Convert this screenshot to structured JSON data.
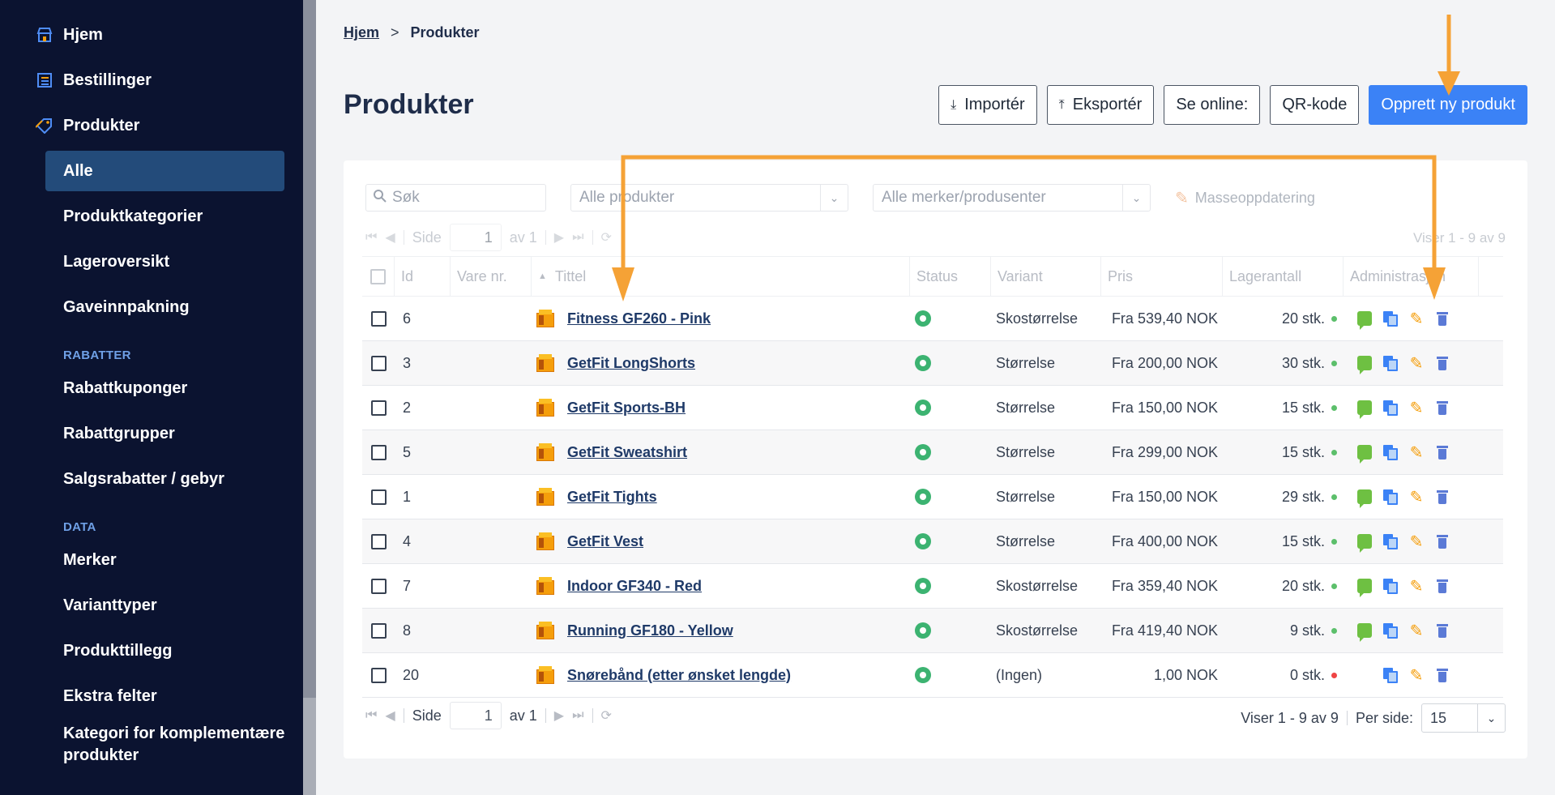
{
  "sidebar": {
    "main_items": [
      {
        "label": "Hjem",
        "icon": "store-icon"
      },
      {
        "label": "Bestillinger",
        "icon": "orders-list-icon"
      },
      {
        "label": "Produkter",
        "icon": "tag-icon"
      }
    ],
    "product_sub": [
      {
        "label": "Alle",
        "active": true
      },
      {
        "label": "Produktkategorier"
      },
      {
        "label": "Lageroversikt"
      },
      {
        "label": "Gaveinnpakning"
      }
    ],
    "section_rabatter": "RABATTER",
    "rabatter_items": [
      {
        "label": "Rabattkuponger"
      },
      {
        "label": "Rabattgrupper"
      },
      {
        "label": "Salgsrabatter / gebyr"
      }
    ],
    "section_data": "DATA",
    "data_items": [
      {
        "label": "Merker"
      },
      {
        "label": "Varianttyper"
      },
      {
        "label": "Produkttillegg"
      },
      {
        "label": "Ekstra felter"
      },
      {
        "label": "Kategori for komplementære produkter"
      }
    ]
  },
  "breadcrumb": {
    "home": "Hjem",
    "sep": ">",
    "current": "Produkter"
  },
  "page_title": "Produkter",
  "toolbar": {
    "import": "Importér",
    "export": "Eksportér",
    "online": "Se online:",
    "qr": "QR-kode",
    "create": "Opprett ny produkt"
  },
  "filters": {
    "search_placeholder": "Søk",
    "products_select": "Alle produkter",
    "brands_select": "Alle merker/produsenter",
    "mass_update": "Masseoppdatering"
  },
  "pager": {
    "page_label": "Side",
    "page_value": "1",
    "of_label": "av 1",
    "viser": "Viser 1 - 9 av 9",
    "per_page_label": "Per side:",
    "per_page_value": "15"
  },
  "columns": {
    "id": "Id",
    "vare": "Vare nr.",
    "title": "Tittel",
    "status": "Status",
    "variant": "Variant",
    "pris": "Pris",
    "lager": "Lagerantall",
    "admin": "Administrasjon"
  },
  "rows": [
    {
      "id": "6",
      "title": "Fitness GF260 - Pink",
      "variant": "Skostørrelse",
      "pris": "Fra 539,40 NOK",
      "lager": "20 stk.",
      "stock_color": "#5cbf6b",
      "comment": true
    },
    {
      "id": "3",
      "title": "GetFit LongShorts",
      "variant": "Størrelse",
      "pris": "Fra 200,00 NOK",
      "lager": "30 stk.",
      "stock_color": "#5cbf6b",
      "comment": true
    },
    {
      "id": "2",
      "title": "GetFit Sports-BH",
      "variant": "Størrelse",
      "pris": "Fra 150,00 NOK",
      "lager": "15 stk.",
      "stock_color": "#5cbf6b",
      "comment": true
    },
    {
      "id": "5",
      "title": "GetFit Sweatshirt",
      "variant": "Størrelse",
      "pris": "Fra 299,00 NOK",
      "lager": "15 stk.",
      "stock_color": "#5cbf6b",
      "comment": true
    },
    {
      "id": "1",
      "title": "GetFit Tights",
      "variant": "Størrelse",
      "pris": "Fra 150,00 NOK",
      "lager": "29 stk.",
      "stock_color": "#5cbf6b",
      "comment": true
    },
    {
      "id": "4",
      "title": "GetFit Vest",
      "variant": "Størrelse",
      "pris": "Fra 400,00 NOK",
      "lager": "15 stk.",
      "stock_color": "#5cbf6b",
      "comment": true
    },
    {
      "id": "7",
      "title": "Indoor GF340 - Red",
      "variant": "Skostørrelse",
      "pris": "Fra 359,40 NOK",
      "lager": "20 stk.",
      "stock_color": "#5cbf6b",
      "comment": true
    },
    {
      "id": "8",
      "title": "Running GF180 - Yellow",
      "variant": "Skostørrelse",
      "pris": "Fra 419,40 NOK",
      "lager": "9 stk.",
      "stock_color": "#5cbf6b",
      "comment": true
    },
    {
      "id": "20",
      "title": "Snørebånd (etter ønsket lengde)",
      "variant": "(Ingen)",
      "pris": "1,00 NOK",
      "lager": "0 stk.",
      "stock_color": "#ef4444",
      "comment": false
    }
  ],
  "colors": {
    "sidebar_bg": "#0b1330",
    "active_item": "#234b7a",
    "primary": "#3b82f6",
    "annotation_arrow": "#f5a236",
    "status_active": "#3cb371"
  }
}
